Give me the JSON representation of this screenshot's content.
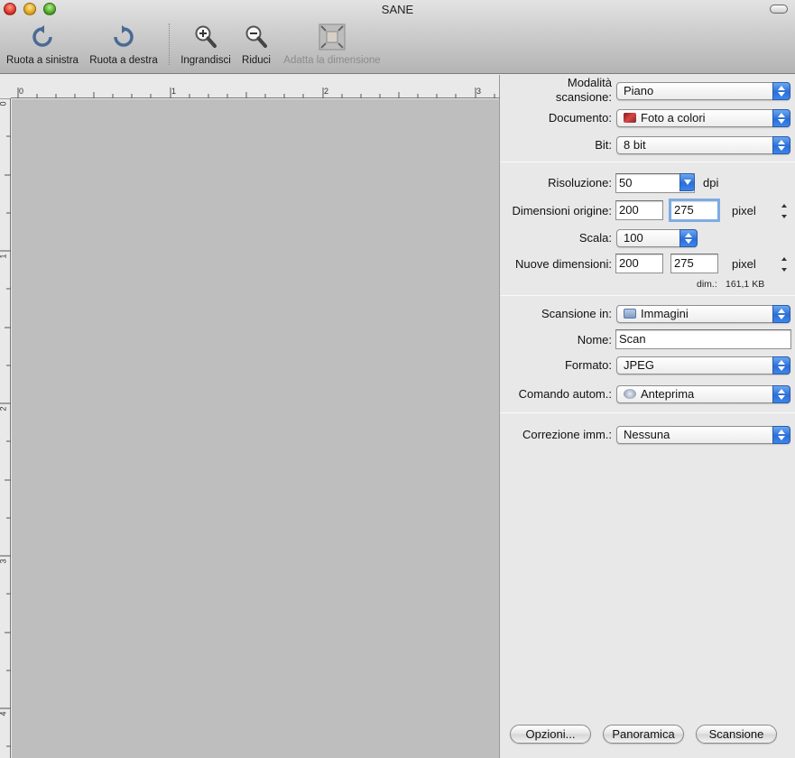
{
  "window": {
    "title": "SANE"
  },
  "toolbar": {
    "rotate_left": "Ruota a sinistra",
    "rotate_right": "Ruota a destra",
    "zoom_in": "Ingrandisci",
    "zoom_out": "Riduci",
    "fit": "Adatta la dimensione"
  },
  "ruler": {
    "h_ticks": [
      "0",
      "1",
      "2",
      "3"
    ],
    "v_ticks": [
      "0",
      "1",
      "2",
      "3",
      "4"
    ]
  },
  "settings": {
    "scan_mode_label_1": "Modalità",
    "scan_mode_label_2": "scansione:",
    "scan_mode_value": "Piano",
    "document_label": "Documento:",
    "document_value": "Foto a colori",
    "bit_label": "Bit:",
    "bit_value": "8 bit",
    "resolution_label": "Risoluzione:",
    "resolution_value": "50",
    "resolution_unit": "dpi",
    "orig_size_label": "Dimensioni origine:",
    "orig_width": "200",
    "orig_height": "275",
    "orig_unit": "pixel",
    "scale_label": "Scala:",
    "scale_value": "100",
    "new_size_label": "Nuove dimensioni:",
    "new_width": "200",
    "new_height": "275",
    "new_unit": "pixel",
    "size_info_label": "dim.:",
    "size_info_value": "161,1 KB",
    "scan_to_label": "Scansione in:",
    "scan_to_value": "Immagini",
    "name_label": "Nome:",
    "name_value": "Scan",
    "format_label": "Formato:",
    "format_value": "JPEG",
    "auto_cmd_label": "Comando autom.:",
    "auto_cmd_value": "Anteprima",
    "correction_label": "Correzione imm.:",
    "correction_value": "Nessuna"
  },
  "buttons": {
    "options": "Opzioni...",
    "overview": "Panoramica",
    "scan": "Scansione"
  },
  "colors": {
    "accent_blue": "#2b6ed7",
    "preview_gray": "#bebebe"
  }
}
